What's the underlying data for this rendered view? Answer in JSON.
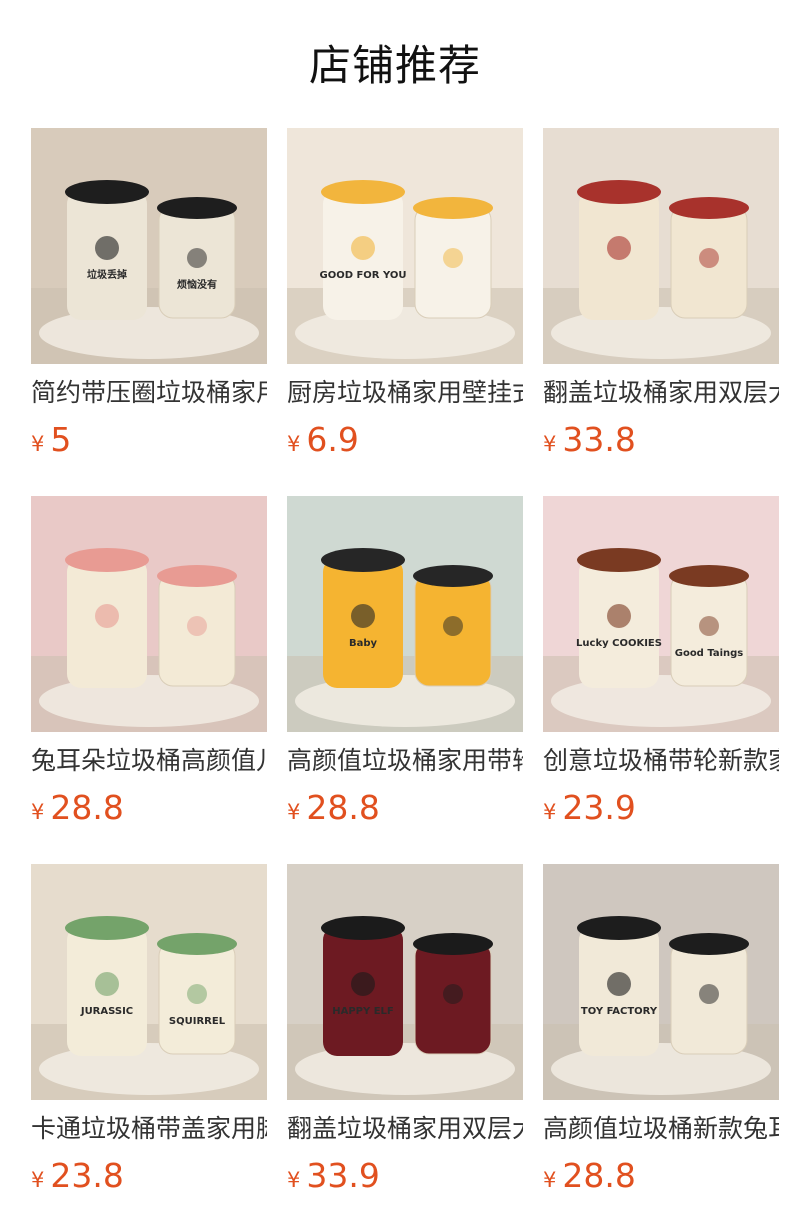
{
  "section_title": "店铺推荐",
  "currency": "¥",
  "products": [
    {
      "name": "简约带压圈垃圾桶家用",
      "price": "5",
      "bg": "#d8cbbb",
      "body": "#ece5d6",
      "accent": "#1e1e1e",
      "img_texts": [
        "垃圾丢掉",
        "烦恼没有"
      ]
    },
    {
      "name": "厨房垃圾桶家用壁挂式",
      "price": "6.9",
      "bg": "#efe6da",
      "body": "#f7f2e8",
      "accent": "#f2b53d",
      "img_texts": [
        "GOOD FOR YOU"
      ]
    },
    {
      "name": "翻盖垃圾桶家用双层大容量",
      "price": "33.8",
      "bg": "#e7ddd2",
      "body": "#f1e6d1",
      "accent": "#a8322c",
      "img_texts": []
    },
    {
      "name": "兔耳朵垃圾桶高颜值儿童",
      "price": "28.8",
      "bg": "#e9c9c7",
      "body": "#f3ead6",
      "accent": "#e89b93",
      "img_texts": []
    },
    {
      "name": "高颜值垃圾桶家用带轮",
      "price": "28.8",
      "bg": "#cfd9d2",
      "body": "#f5b431",
      "accent": "#262626",
      "img_texts": [
        "Baby"
      ]
    },
    {
      "name": "创意垃圾桶带轮新款家用",
      "price": "23.9",
      "bg": "#efd6d6",
      "body": "#f4ecdc",
      "accent": "#7a3a22",
      "img_texts": [
        "Lucky COOKIES",
        "Good Taings"
      ]
    },
    {
      "name": "卡通垃圾桶带盖家用脚踏",
      "price": "23.8",
      "bg": "#e6dccd",
      "body": "#f3ecd9",
      "accent": "#74a36a",
      "img_texts": [
        "JURASSIC",
        "SQUIRREL"
      ]
    },
    {
      "name": "翻盖垃圾桶家用双层大号",
      "price": "33.9",
      "bg": "#d7d0c6",
      "body": "#6d1a22",
      "accent": "#1b1b1b",
      "img_texts": [
        "HAPPY ELF"
      ]
    },
    {
      "name": "高颜值垃圾桶新款兔耳朵",
      "price": "28.8",
      "bg": "#cfc7bf",
      "body": "#f1e9d8",
      "accent": "#1d1d1d",
      "img_texts": [
        "TOY FACTORY"
      ]
    }
  ]
}
